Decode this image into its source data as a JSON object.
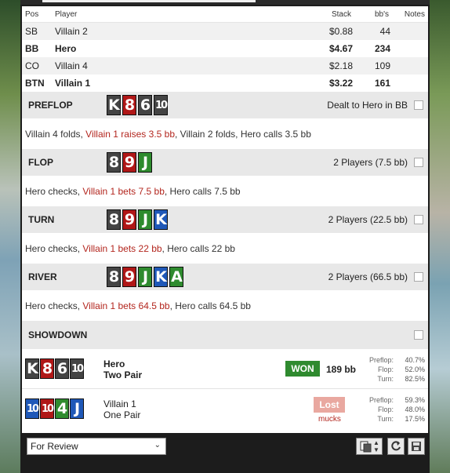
{
  "players": {
    "headers": {
      "pos": "Pos",
      "player": "Player",
      "stack": "Stack",
      "bbs": "bb's",
      "notes": "Notes"
    },
    "rows": [
      {
        "pos": "SB",
        "player": "Villain 2",
        "stack": "$0.88",
        "bbs": "44",
        "bold": false
      },
      {
        "pos": "BB",
        "player": "Hero",
        "stack": "$4.67",
        "bbs": "234",
        "bold": true
      },
      {
        "pos": "CO",
        "player": "Villain 4",
        "stack": "$2.18",
        "bbs": "109",
        "bold": false
      },
      {
        "pos": "BTN",
        "player": "Villain 1",
        "stack": "$3.22",
        "bbs": "161",
        "bold": true
      }
    ]
  },
  "preflop": {
    "name": "PREFLOP",
    "info": "Dealt to Hero in BB",
    "cards": [
      {
        "r": "K",
        "s": "s"
      },
      {
        "r": "8",
        "s": "h"
      },
      {
        "r": "6",
        "s": "s"
      },
      {
        "r": "10",
        "s": "s"
      }
    ],
    "actions": [
      {
        "t": "Villain 4 folds, ",
        "red": false
      },
      {
        "t": "Villain 1 raises 3.5 bb",
        "red": true
      },
      {
        "t": ", Villain 2 folds, Hero calls 3.5 bb",
        "red": false
      }
    ]
  },
  "flop": {
    "name": "FLOP",
    "info": "2 Players (7.5 bb)",
    "cards": [
      {
        "r": "8",
        "s": "s"
      },
      {
        "r": "9",
        "s": "h"
      },
      {
        "r": "J",
        "s": "c"
      }
    ],
    "actions": [
      {
        "t": "Hero checks, ",
        "red": false
      },
      {
        "t": "Villain 1 bets 7.5 bb",
        "red": true
      },
      {
        "t": ", Hero calls 7.5 bb",
        "red": false
      }
    ]
  },
  "turn": {
    "name": "TURN",
    "info": "2 Players (22.5 bb)",
    "cards": [
      {
        "r": "8",
        "s": "s"
      },
      {
        "r": "9",
        "s": "h"
      },
      {
        "r": "J",
        "s": "c"
      },
      {
        "r": "K",
        "s": "d"
      }
    ],
    "actions": [
      {
        "t": "Hero checks, ",
        "red": false
      },
      {
        "t": "Villain 1 bets 22 bb",
        "red": true
      },
      {
        "t": ", Hero calls 22 bb",
        "red": false
      }
    ]
  },
  "river": {
    "name": "RIVER",
    "info": "2 Players (66.5 bb)",
    "cards": [
      {
        "r": "8",
        "s": "s"
      },
      {
        "r": "9",
        "s": "h"
      },
      {
        "r": "J",
        "s": "c"
      },
      {
        "r": "K",
        "s": "d"
      },
      {
        "r": "A",
        "s": "c"
      }
    ],
    "actions": [
      {
        "t": "Hero checks, ",
        "red": false
      },
      {
        "t": "Villain 1 bets 64.5 bb",
        "red": true
      },
      {
        "t": ", Hero calls 64.5 bb",
        "red": false
      }
    ]
  },
  "showdown": {
    "name": "SHOWDOWN",
    "hero": {
      "name": "Hero",
      "hand": "Two Pair",
      "badge": "WON",
      "amount": "189 bb",
      "cards": [
        {
          "r": "K",
          "s": "s"
        },
        {
          "r": "8",
          "s": "h"
        },
        {
          "r": "6",
          "s": "s"
        },
        {
          "r": "10",
          "s": "s"
        }
      ],
      "equity": [
        {
          "label": "Preflop:",
          "value": "40.7%"
        },
        {
          "label": "Flop:",
          "value": "52.0%"
        },
        {
          "label": "Turn:",
          "value": "82.5%"
        }
      ]
    },
    "villain": {
      "name": "Villain 1",
      "hand": "One Pair",
      "badge": "Lost",
      "note": "mucks",
      "cards": [
        {
          "r": "10",
          "s": "d"
        },
        {
          "r": "10",
          "s": "h"
        },
        {
          "r": "4",
          "s": "c"
        },
        {
          "r": "J",
          "s": "d"
        }
      ],
      "equity": [
        {
          "label": "Preflop:",
          "value": "59.3%"
        },
        {
          "label": "Flop:",
          "value": "48.0%"
        },
        {
          "label": "Turn:",
          "value": "17.5%"
        }
      ]
    }
  },
  "footer": {
    "review_select": "For Review",
    "icons": [
      "copy-icon",
      "dropdown-icon",
      "refresh-icon",
      "save-icon"
    ]
  },
  "colors": {
    "spade": "#444444",
    "heart": "#b01717",
    "club": "#2e8b2e",
    "diamond": "#1f58b8",
    "won": "#2f8a2f",
    "lost": "#e9a8a0",
    "action_red": "#b3261e"
  }
}
